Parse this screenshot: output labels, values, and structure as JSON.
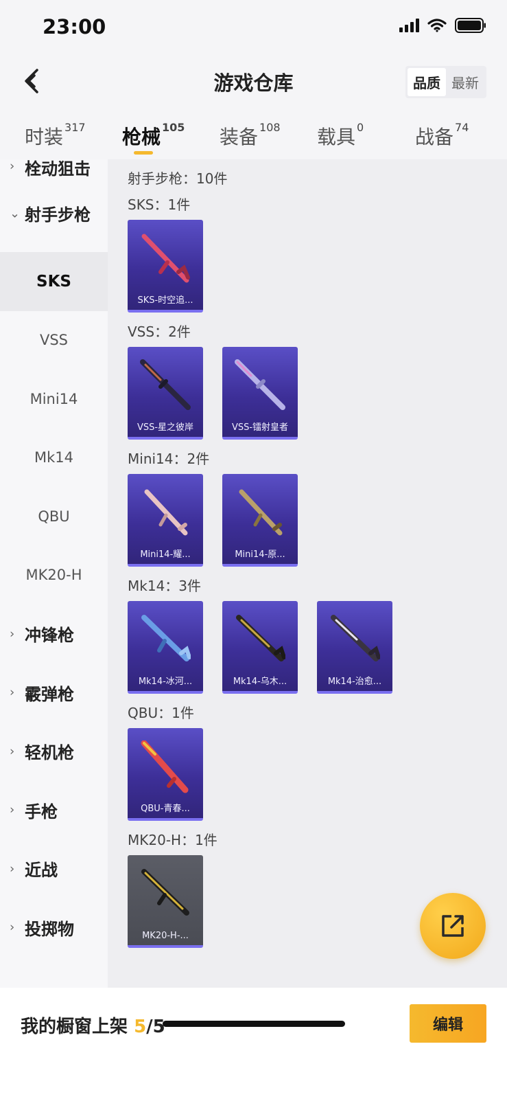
{
  "status_bar": {
    "time": "23:00"
  },
  "header": {
    "title": "游戏仓库",
    "sort_options": [
      "品质",
      "最新"
    ],
    "sort_active": "品质"
  },
  "tabs": [
    {
      "label": "时装",
      "count": "317"
    },
    {
      "label": "枪械",
      "count": "105"
    },
    {
      "label": "装备",
      "count": "108"
    },
    {
      "label": "载具",
      "count": "0"
    },
    {
      "label": "战备",
      "count": "74"
    }
  ],
  "sidebar": {
    "cat_bolt": "栓动狙击",
    "cat_marksman": "射手步枪",
    "subs": [
      "SKS",
      "VSS",
      "Mini14",
      "Mk14",
      "QBU",
      "MK20-H"
    ],
    "cats_after": [
      "冲锋枪",
      "霰弹枪",
      "轻机枪",
      "手枪",
      "近战",
      "投掷物"
    ]
  },
  "content": {
    "total": "射手步枪：10件",
    "groups": [
      {
        "head": "SKS：1件",
        "items": [
          "SKS-时空追..."
        ]
      },
      {
        "head": "VSS：2件",
        "items": [
          "VSS-星之彼岸",
          "VSS-镭射皇者"
        ]
      },
      {
        "head": "Mini14：2件",
        "items": [
          "Mini14-耀...",
          "Mini14-原..."
        ]
      },
      {
        "head": "Mk14：3件",
        "items": [
          "Mk14-冰河...",
          "Mk14-乌木...",
          "Mk14-治愈..."
        ]
      },
      {
        "head": "QBU：1件",
        "items": [
          "QBU-青春..."
        ]
      },
      {
        "head": "MK20-H：1件",
        "items": [
          "MK20-H-..."
        ]
      }
    ]
  },
  "footer": {
    "showcase_label": "我的橱窗上架",
    "showcase_current": "5",
    "showcase_total": "/5",
    "edit_label": "编辑"
  },
  "icons": {
    "fab": "share-external-icon",
    "back": "back-arrow-icon"
  }
}
